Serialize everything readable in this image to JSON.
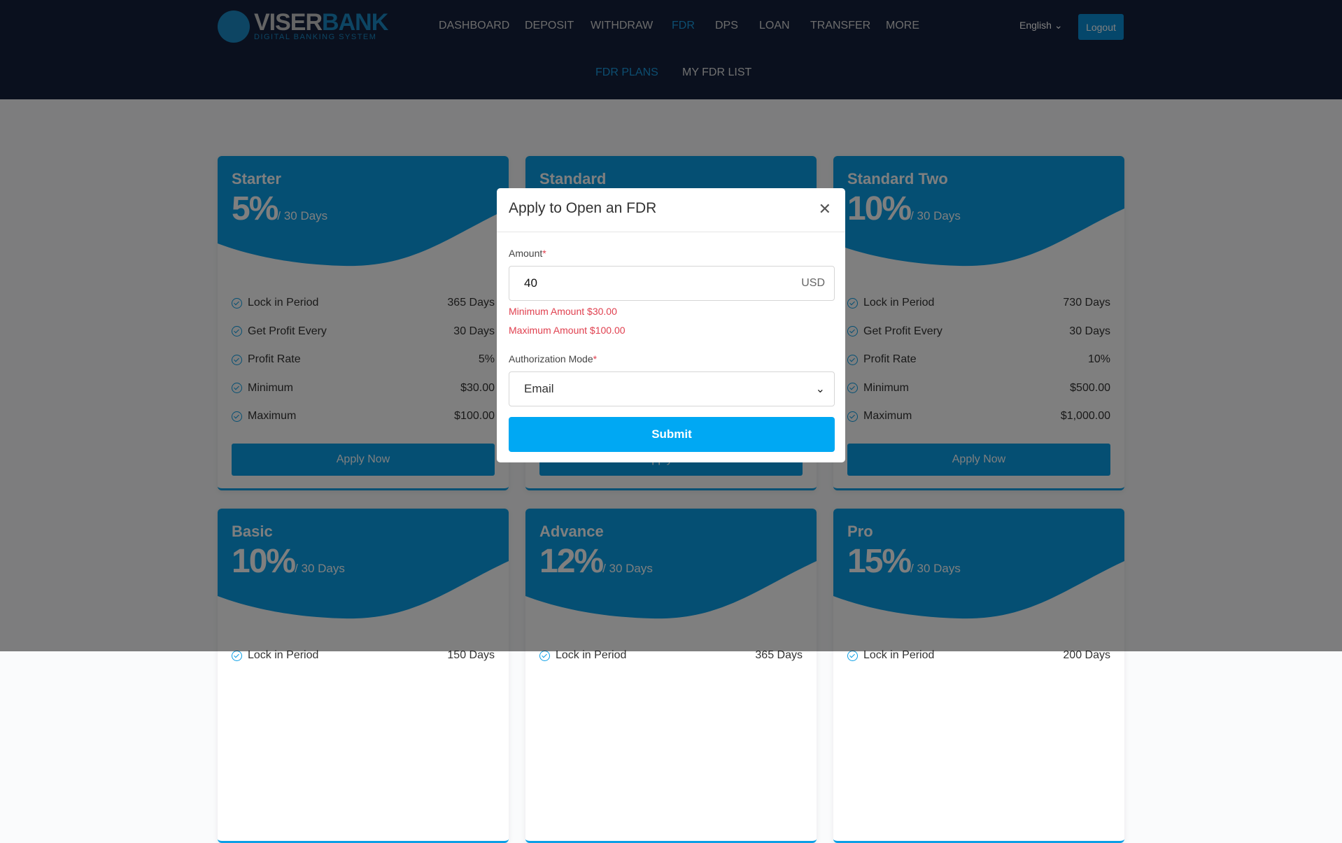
{
  "logo": {
    "main_a": "VISER",
    "main_b": "BANK",
    "sub": "DIGITAL BANKING SYSTEM"
  },
  "nav": [
    "DASHBOARD",
    "DEPOSIT",
    "WITHDRAW",
    "FDR",
    "DPS",
    "LOAN",
    "TRANSFER",
    "MORE"
  ],
  "active_nav": "FDR",
  "language": "English",
  "logout": "Logout",
  "subnav": [
    "FDR PLANS",
    "MY FDR LIST"
  ],
  "colors": {
    "accent": "#00a8f3",
    "card": "#0a9fe6",
    "error": "#e0404f"
  },
  "plans": [
    {
      "name": "Starter",
      "rate": "5%",
      "per": "/ 30 Days",
      "rows": [
        [
          "Lock in Period",
          "365 Days"
        ],
        [
          "Get Profit Every",
          "30 Days"
        ],
        [
          "Profit Rate",
          "5%"
        ],
        [
          "Minimum",
          "$30.00"
        ],
        [
          "Maximum",
          "$100.00"
        ]
      ],
      "button": "Apply Now"
    },
    {
      "name": "Standard",
      "button": "Apply Now"
    },
    {
      "name": "Standard Two",
      "rate": "10%",
      "per": "/ 30 Days",
      "rows": [
        [
          "Lock in Period",
          "730 Days"
        ],
        [
          "Get Profit Every",
          "30 Days"
        ],
        [
          "Profit Rate",
          "10%"
        ],
        [
          "Minimum",
          "$500.00"
        ],
        [
          "Maximum",
          "$1,000.00"
        ]
      ],
      "button": "Apply Now"
    },
    {
      "name": "Basic",
      "rate": "10%",
      "per": "/ 30 Days",
      "rows": [
        [
          "Lock in Period",
          "150 Days"
        ]
      ]
    },
    {
      "name": "Advance",
      "rate": "12%",
      "per": "/ 30 Days",
      "rows": [
        [
          "Lock in Period",
          "365 Days"
        ]
      ]
    },
    {
      "name": "Pro",
      "rate": "15%",
      "per": "/ 30 Days",
      "rows": [
        [
          "Lock in Period",
          "200 Days"
        ]
      ]
    }
  ],
  "modal": {
    "title": "Apply to Open an FDR",
    "amount_label": "Amount",
    "required": "*",
    "amount_value": "40",
    "currency": "USD",
    "min_text": "Minimum Amount $30.00",
    "max_text": "Maximum Amount $100.00",
    "auth_label": "Authorization Mode",
    "auth_value": "Email",
    "submit": "Submit"
  }
}
